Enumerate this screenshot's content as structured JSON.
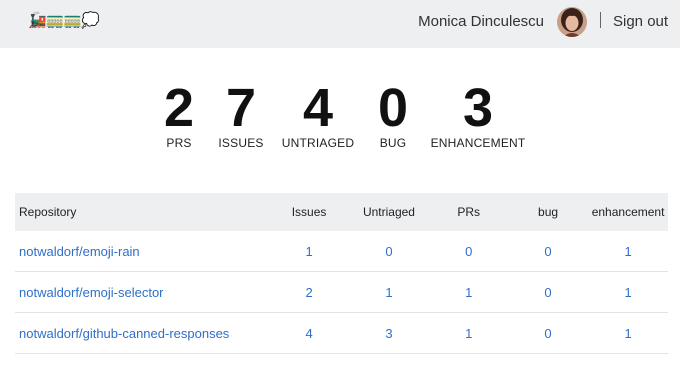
{
  "header": {
    "logo_emoji": "🚂🚃🚃💭",
    "user_name": "Monica Dinculescu",
    "signout_label": "Sign out"
  },
  "stats": [
    {
      "value": "2",
      "label": "PRS"
    },
    {
      "value": "7",
      "label": "ISSUES"
    },
    {
      "value": "4",
      "label": "UNTRIAGED"
    },
    {
      "value": "0",
      "label": "BUG"
    },
    {
      "value": "3",
      "label": "ENHANCEMENT"
    }
  ],
  "table": {
    "headers": [
      "Repository",
      "Issues",
      "Untriaged",
      "PRs",
      "bug",
      "enhancement"
    ],
    "rows": [
      {
        "repo": "notwaldorf/emoji-rain",
        "issues": "1",
        "untriaged": "0",
        "prs": "0",
        "bug": "0",
        "enhancement": "1"
      },
      {
        "repo": "notwaldorf/emoji-selector",
        "issues": "2",
        "untriaged": "1",
        "prs": "1",
        "bug": "0",
        "enhancement": "1"
      },
      {
        "repo": "notwaldorf/github-canned-responses",
        "issues": "4",
        "untriaged": "3",
        "prs": "1",
        "bug": "0",
        "enhancement": "1"
      }
    ]
  },
  "colors": {
    "link": "#2f6fca",
    "header_bg": "#eeeff0"
  }
}
